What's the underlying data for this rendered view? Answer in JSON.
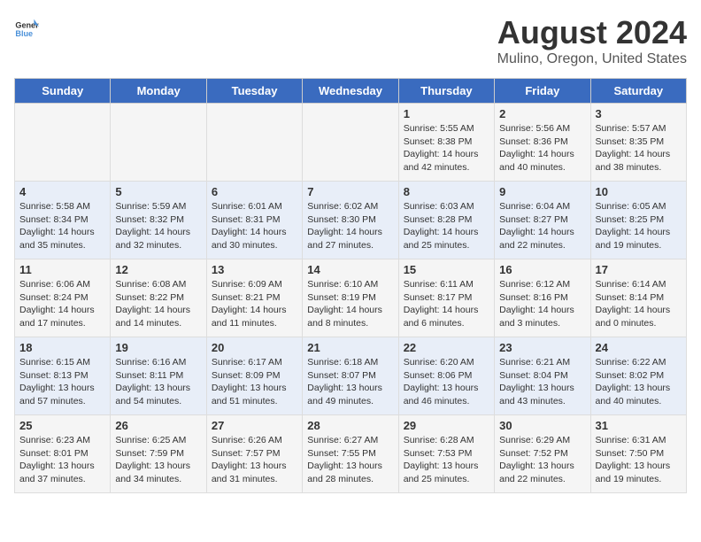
{
  "header": {
    "logo_general": "General",
    "logo_blue": "Blue",
    "main_title": "August 2024",
    "subtitle": "Mulino, Oregon, United States"
  },
  "days_of_week": [
    "Sunday",
    "Monday",
    "Tuesday",
    "Wednesday",
    "Thursday",
    "Friday",
    "Saturday"
  ],
  "weeks": [
    [
      {
        "day": "",
        "content": ""
      },
      {
        "day": "",
        "content": ""
      },
      {
        "day": "",
        "content": ""
      },
      {
        "day": "",
        "content": ""
      },
      {
        "day": "1",
        "content": "Sunrise: 5:55 AM\nSunset: 8:38 PM\nDaylight: 14 hours\nand 42 minutes."
      },
      {
        "day": "2",
        "content": "Sunrise: 5:56 AM\nSunset: 8:36 PM\nDaylight: 14 hours\nand 40 minutes."
      },
      {
        "day": "3",
        "content": "Sunrise: 5:57 AM\nSunset: 8:35 PM\nDaylight: 14 hours\nand 38 minutes."
      }
    ],
    [
      {
        "day": "4",
        "content": "Sunrise: 5:58 AM\nSunset: 8:34 PM\nDaylight: 14 hours\nand 35 minutes."
      },
      {
        "day": "5",
        "content": "Sunrise: 5:59 AM\nSunset: 8:32 PM\nDaylight: 14 hours\nand 32 minutes."
      },
      {
        "day": "6",
        "content": "Sunrise: 6:01 AM\nSunset: 8:31 PM\nDaylight: 14 hours\nand 30 minutes."
      },
      {
        "day": "7",
        "content": "Sunrise: 6:02 AM\nSunset: 8:30 PM\nDaylight: 14 hours\nand 27 minutes."
      },
      {
        "day": "8",
        "content": "Sunrise: 6:03 AM\nSunset: 8:28 PM\nDaylight: 14 hours\nand 25 minutes."
      },
      {
        "day": "9",
        "content": "Sunrise: 6:04 AM\nSunset: 8:27 PM\nDaylight: 14 hours\nand 22 minutes."
      },
      {
        "day": "10",
        "content": "Sunrise: 6:05 AM\nSunset: 8:25 PM\nDaylight: 14 hours\nand 19 minutes."
      }
    ],
    [
      {
        "day": "11",
        "content": "Sunrise: 6:06 AM\nSunset: 8:24 PM\nDaylight: 14 hours\nand 17 minutes."
      },
      {
        "day": "12",
        "content": "Sunrise: 6:08 AM\nSunset: 8:22 PM\nDaylight: 14 hours\nand 14 minutes."
      },
      {
        "day": "13",
        "content": "Sunrise: 6:09 AM\nSunset: 8:21 PM\nDaylight: 14 hours\nand 11 minutes."
      },
      {
        "day": "14",
        "content": "Sunrise: 6:10 AM\nSunset: 8:19 PM\nDaylight: 14 hours\nand 8 minutes."
      },
      {
        "day": "15",
        "content": "Sunrise: 6:11 AM\nSunset: 8:17 PM\nDaylight: 14 hours\nand 6 minutes."
      },
      {
        "day": "16",
        "content": "Sunrise: 6:12 AM\nSunset: 8:16 PM\nDaylight: 14 hours\nand 3 minutes."
      },
      {
        "day": "17",
        "content": "Sunrise: 6:14 AM\nSunset: 8:14 PM\nDaylight: 14 hours\nand 0 minutes."
      }
    ],
    [
      {
        "day": "18",
        "content": "Sunrise: 6:15 AM\nSunset: 8:13 PM\nDaylight: 13 hours\nand 57 minutes."
      },
      {
        "day": "19",
        "content": "Sunrise: 6:16 AM\nSunset: 8:11 PM\nDaylight: 13 hours\nand 54 minutes."
      },
      {
        "day": "20",
        "content": "Sunrise: 6:17 AM\nSunset: 8:09 PM\nDaylight: 13 hours\nand 51 minutes."
      },
      {
        "day": "21",
        "content": "Sunrise: 6:18 AM\nSunset: 8:07 PM\nDaylight: 13 hours\nand 49 minutes."
      },
      {
        "day": "22",
        "content": "Sunrise: 6:20 AM\nSunset: 8:06 PM\nDaylight: 13 hours\nand 46 minutes."
      },
      {
        "day": "23",
        "content": "Sunrise: 6:21 AM\nSunset: 8:04 PM\nDaylight: 13 hours\nand 43 minutes."
      },
      {
        "day": "24",
        "content": "Sunrise: 6:22 AM\nSunset: 8:02 PM\nDaylight: 13 hours\nand 40 minutes."
      }
    ],
    [
      {
        "day": "25",
        "content": "Sunrise: 6:23 AM\nSunset: 8:01 PM\nDaylight: 13 hours\nand 37 minutes."
      },
      {
        "day": "26",
        "content": "Sunrise: 6:25 AM\nSunset: 7:59 PM\nDaylight: 13 hours\nand 34 minutes."
      },
      {
        "day": "27",
        "content": "Sunrise: 6:26 AM\nSunset: 7:57 PM\nDaylight: 13 hours\nand 31 minutes."
      },
      {
        "day": "28",
        "content": "Sunrise: 6:27 AM\nSunset: 7:55 PM\nDaylight: 13 hours\nand 28 minutes."
      },
      {
        "day": "29",
        "content": "Sunrise: 6:28 AM\nSunset: 7:53 PM\nDaylight: 13 hours\nand 25 minutes."
      },
      {
        "day": "30",
        "content": "Sunrise: 6:29 AM\nSunset: 7:52 PM\nDaylight: 13 hours\nand 22 minutes."
      },
      {
        "day": "31",
        "content": "Sunrise: 6:31 AM\nSunset: 7:50 PM\nDaylight: 13 hours\nand 19 minutes."
      }
    ]
  ]
}
